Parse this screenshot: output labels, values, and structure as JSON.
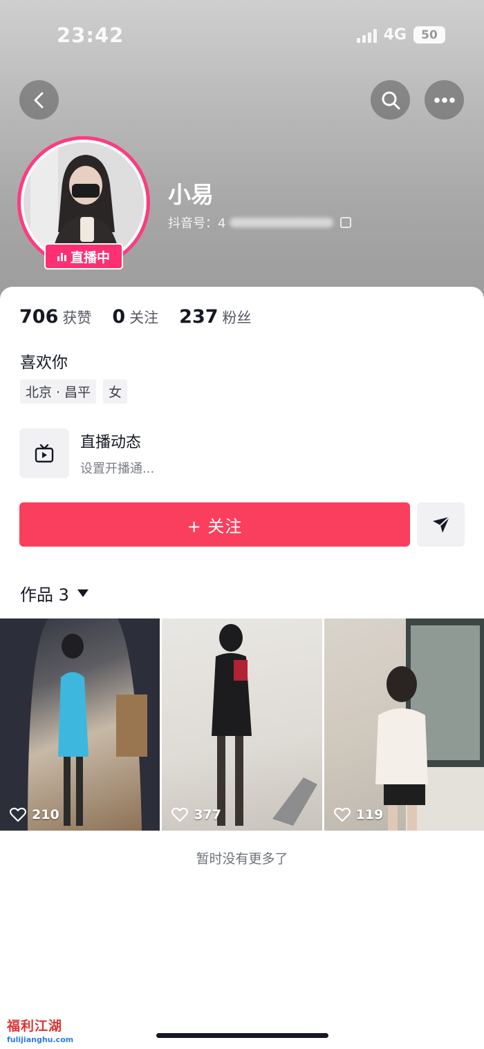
{
  "status_bar": {
    "time": "23:42",
    "network": "4G",
    "battery": "50"
  },
  "nav": {
    "back_icon": "chevron-left-icon",
    "search_icon": "search-icon",
    "more_icon": "more-dots-icon"
  },
  "profile": {
    "live_badge": "直播中",
    "nickname": "小易",
    "douyin_id_label": "抖音号：4",
    "stats": [
      {
        "value": "706",
        "label": "获赞"
      },
      {
        "value": "0",
        "label": "关注"
      },
      {
        "value": "237",
        "label": "粉丝"
      }
    ],
    "bio": "喜欢你",
    "tags": [
      "北京 · 昌平",
      "女"
    ]
  },
  "live_dynamic": {
    "title": "直播动态",
    "subtitle": "设置开播通..."
  },
  "actions": {
    "follow_label": "+ 关注",
    "share_icon": "send-icon"
  },
  "works": {
    "label": "作品 3",
    "items": [
      {
        "likes": "210"
      },
      {
        "likes": "377"
      },
      {
        "likes": "119"
      }
    ],
    "end_text": "暂时没有更多了"
  },
  "watermark": {
    "logo_text": "福利江湖",
    "url": "fulijianghu.com"
  },
  "colors": {
    "accent": "#f93f5d",
    "live_pink": "#ff2f73"
  }
}
